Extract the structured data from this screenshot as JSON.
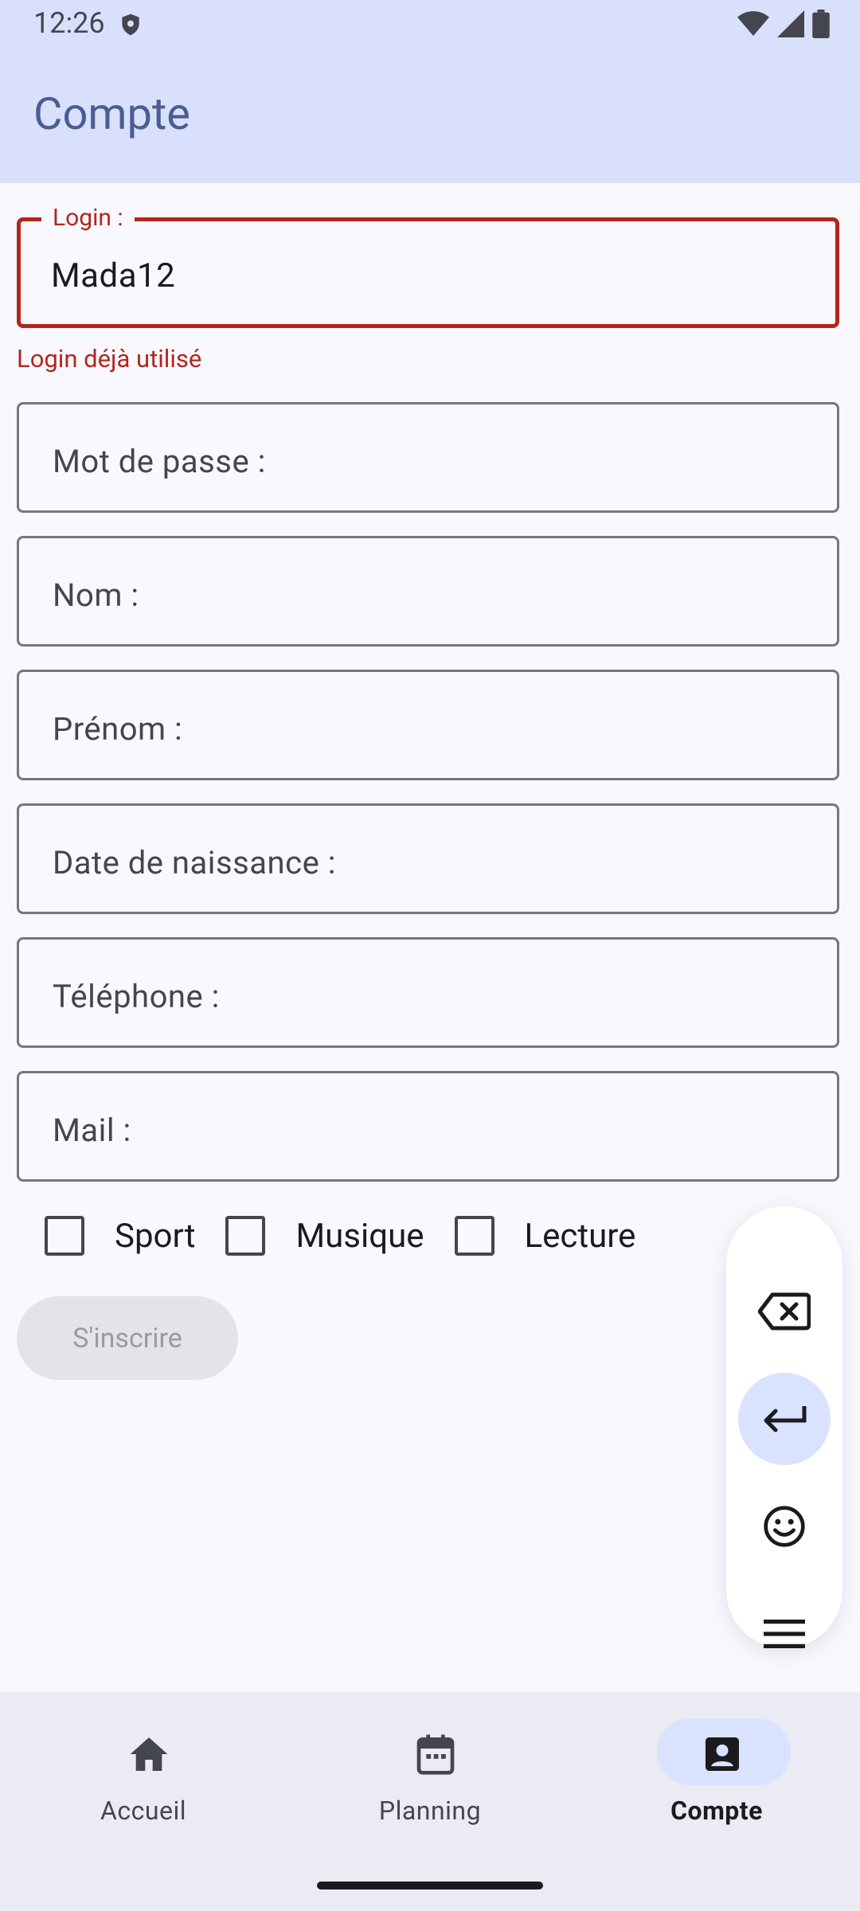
{
  "status_bar": {
    "time": "12:26"
  },
  "app_bar": {
    "title": "Compte"
  },
  "form": {
    "login": {
      "label": "Login :",
      "value": "Mada12",
      "error": "Login déjà utilisé"
    },
    "password": {
      "placeholder": "Mot de passe :"
    },
    "nom": {
      "placeholder": "Nom :"
    },
    "prenom": {
      "placeholder": "Prénom :"
    },
    "birthdate": {
      "placeholder": "Date de naissance :"
    },
    "telephone": {
      "placeholder": "Téléphone :"
    },
    "mail": {
      "placeholder": "Mail :"
    },
    "checkboxes": [
      {
        "label": "Sport",
        "checked": false
      },
      {
        "label": "Musique",
        "checked": false
      },
      {
        "label": "Lecture",
        "checked": false
      }
    ],
    "register_button": "S'inscrire"
  },
  "keyboard_panel": {
    "buttons": [
      "backspace-icon",
      "enter-icon",
      "emoji-icon",
      "menu-icon"
    ],
    "active_color": "#d9e2ff"
  },
  "bottom_nav": {
    "items": [
      {
        "label": "Accueil",
        "icon": "home-icon",
        "active": false
      },
      {
        "label": "Planning",
        "icon": "calendar-icon",
        "active": false
      },
      {
        "label": "Compte",
        "icon": "account-box-icon",
        "active": true
      }
    ]
  },
  "colors": {
    "error": "#b3261e",
    "app_bar_bg": "#d9e0fb",
    "title": "#4a5d94"
  }
}
